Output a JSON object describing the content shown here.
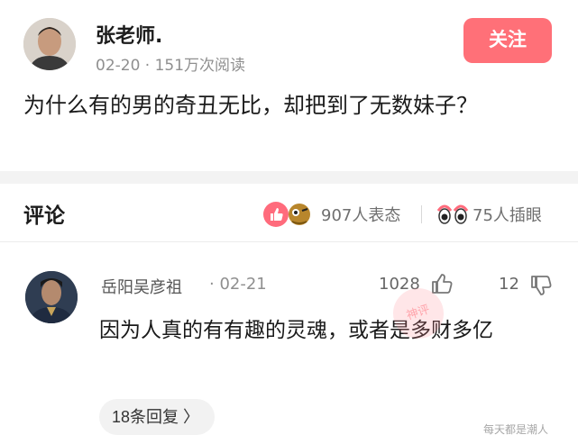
{
  "post": {
    "author_name": "张老师.",
    "meta": "02-20 · 151万次阅读",
    "follow_label": "关注",
    "question": "为什么有的男的奇丑无比，却把到了无数妹子？"
  },
  "comments_header": {
    "title": "评论",
    "reactions": "907人表态",
    "watch": "75人插眼"
  },
  "comment": {
    "author": "岳阳吴彦祖",
    "date": "· 02-21",
    "like_count": "1028",
    "dislike_count": "12",
    "text": "因为人真的有有趣的灵魂，或者是多财多亿",
    "replies_label": "18条回复 〉"
  },
  "watermark": "每天都是潮人",
  "stamp_text": "神评",
  "colors": {
    "accent": "#ff7078",
    "secondary_text": "#8f8f8f"
  }
}
